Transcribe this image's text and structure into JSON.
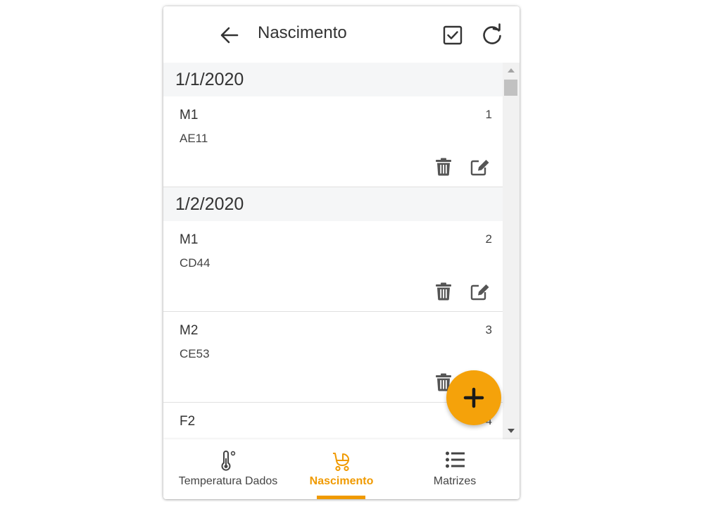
{
  "header": {
    "title": "Nascimento"
  },
  "groups": [
    {
      "date": "1/1/2020",
      "items": [
        {
          "name": "M1",
          "code": "AE11",
          "number": "1"
        }
      ]
    },
    {
      "date": "1/2/2020",
      "items": [
        {
          "name": "M1",
          "code": "CD44",
          "number": "2"
        },
        {
          "name": "M2",
          "code": "CE53",
          "number": "3"
        },
        {
          "name": "F2",
          "code": "",
          "number": "4"
        }
      ]
    }
  ],
  "nav": [
    {
      "label": "Temperatura Dados",
      "icon": "thermometer-icon"
    },
    {
      "label": "Nascimento",
      "icon": "baby-carriage-icon",
      "active": true
    },
    {
      "label": "Matrizes",
      "icon": "list-icon"
    }
  ],
  "colors": {
    "accent": "#f5a20a",
    "active_nav": "#f09a00",
    "date_header_bg": "#f5f6f7"
  },
  "icons": [
    "arrow-left-icon",
    "checkbox-icon",
    "refresh-icon",
    "trash-icon",
    "edit-icon",
    "plus-icon"
  ]
}
